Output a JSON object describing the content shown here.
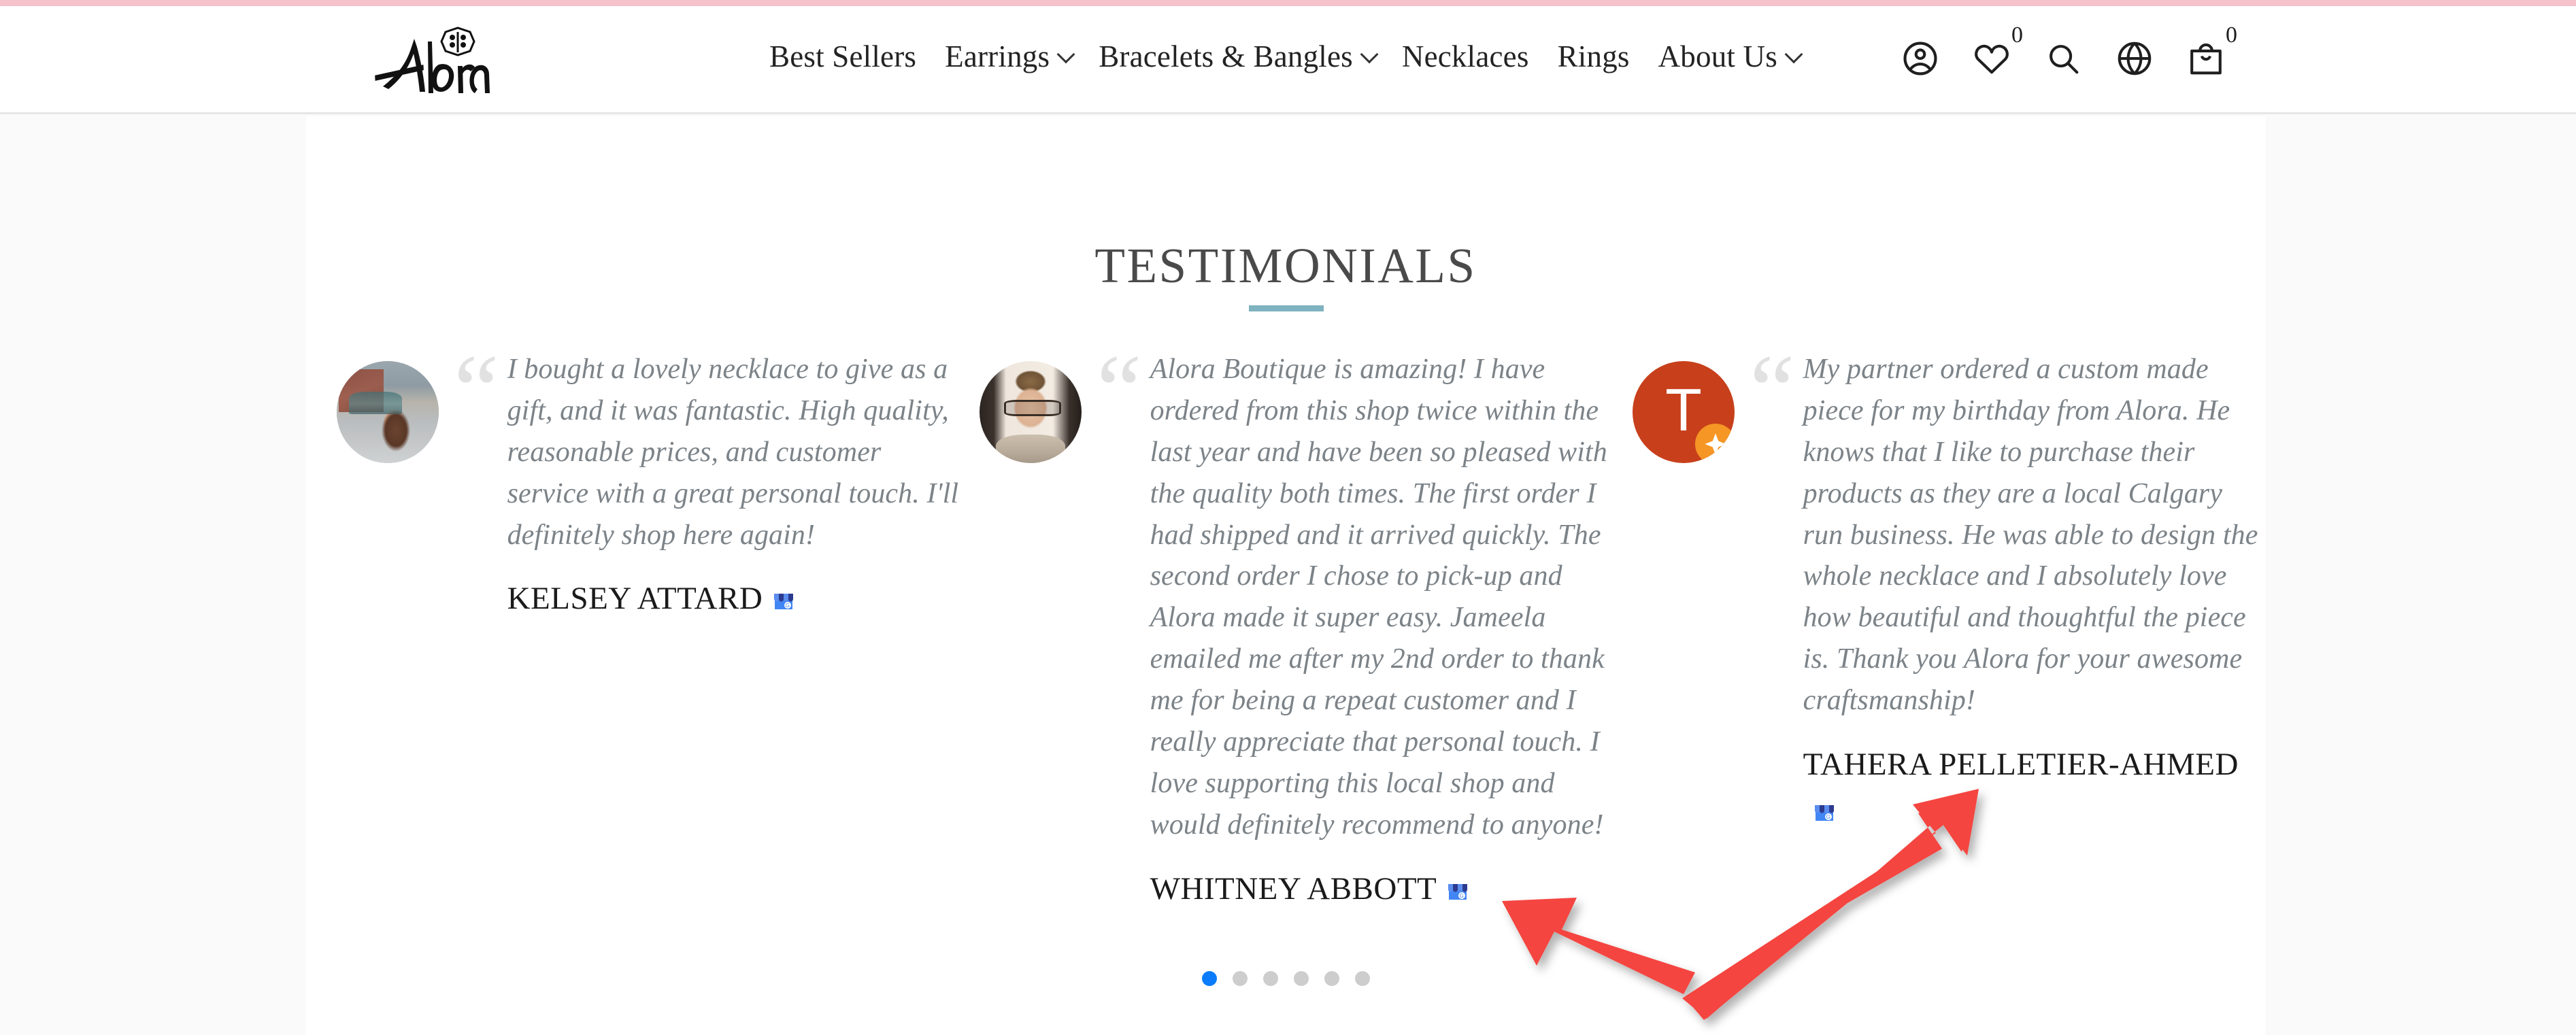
{
  "brand": {
    "name": "Alora"
  },
  "header": {
    "nav": [
      {
        "label": "Best Sellers",
        "has_dropdown": false
      },
      {
        "label": "Earrings",
        "has_dropdown": true
      },
      {
        "label": "Bracelets & Bangles",
        "has_dropdown": true
      },
      {
        "label": "Necklaces",
        "has_dropdown": false
      },
      {
        "label": "Rings",
        "has_dropdown": false
      },
      {
        "label": "About Us",
        "has_dropdown": true
      }
    ],
    "icons": [
      {
        "name": "account-icon",
        "count": ""
      },
      {
        "name": "wishlist-heart-icon",
        "count": "0"
      },
      {
        "name": "search-icon",
        "count": ""
      },
      {
        "name": "language-globe-icon",
        "count": ""
      },
      {
        "name": "shopping-bag-icon",
        "count": "0"
      }
    ]
  },
  "section": {
    "title": "TESTIMONIALS",
    "underline_color": "#7fb3c0"
  },
  "testimonials": [
    {
      "quote": "I bought a lovely necklace to give as a gift, and it was fantastic. High quality, reasonable prices, and customer service with a great personal touch. I'll definitely shop here again!",
      "author": "KELSEY ATTARD",
      "source_badge": "google-business-profile-icon",
      "avatar_type": "photo"
    },
    {
      "quote": "Alora Boutique is amazing! I have ordered from this shop twice within the last year and have been so pleased with the quality both times. The first order I had shipped and it arrived quickly. The second order I chose to pick-up and Alora made it super easy. Jameela emailed me after my 2nd order to thank me for being a repeat customer and I really appreciate that personal touch. I love supporting this local shop and would definitely recommend to anyone!",
      "author": "WHITNEY ABBOTT",
      "source_badge": "google-business-profile-icon",
      "avatar_type": "photo"
    },
    {
      "quote": "My partner ordered a custom made piece for my birthday from Alora. He knows that I like to purchase their products as they are a local Calgary run business. He was able to design the whole necklace and I absolutely love how beautiful and thoughtful the piece is. Thank you Alora for your awesome craftsmanship!",
      "author": "TAHERA PELLETIER-AHMED",
      "source_badge": "google-business-profile-icon",
      "avatar_type": "initial",
      "avatar_initial": "T",
      "avatar_color": "#c7401b",
      "local_guide_badge_color": "#f59625"
    }
  ],
  "pagination": {
    "total": 6,
    "active_index": 0,
    "active_color": "#0a7cfb",
    "inactive_color": "#cdcdcd"
  },
  "annotations": {
    "arrow_color": "#f4453f",
    "arrows": [
      {
        "name": "arrow-to-whitney-badge",
        "direction": "left"
      },
      {
        "name": "arrow-to-tahera-badge",
        "direction": "up-right"
      }
    ]
  },
  "theme": {
    "accent_pink": "#f4c3cb",
    "title_color": "#4a4a4a",
    "quote_color": "#7c8388"
  }
}
